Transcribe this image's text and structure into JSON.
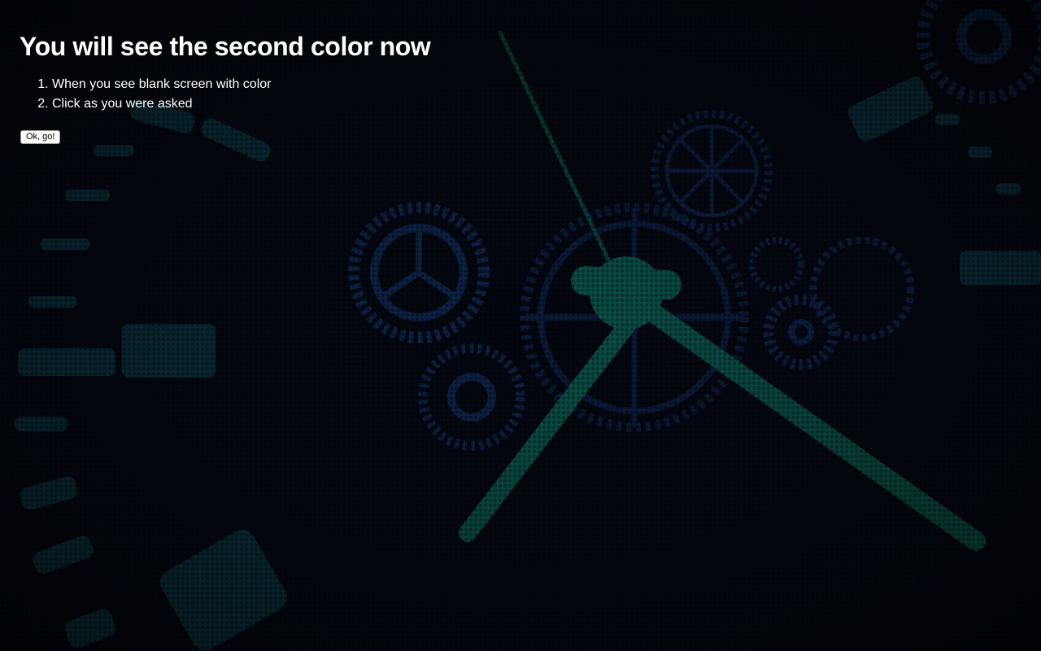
{
  "heading": "You will see the second color now",
  "instructions": [
    "When you see blank screen with color",
    "Click as you were asked"
  ],
  "button_label": "Ok, go!",
  "background": {
    "description_icon": "clock-gears-icon",
    "base_color": "#03060d",
    "gear_color": "#0f2a52",
    "hand_color": "#0c5a4e",
    "accent_color": "#0d3f4a"
  }
}
